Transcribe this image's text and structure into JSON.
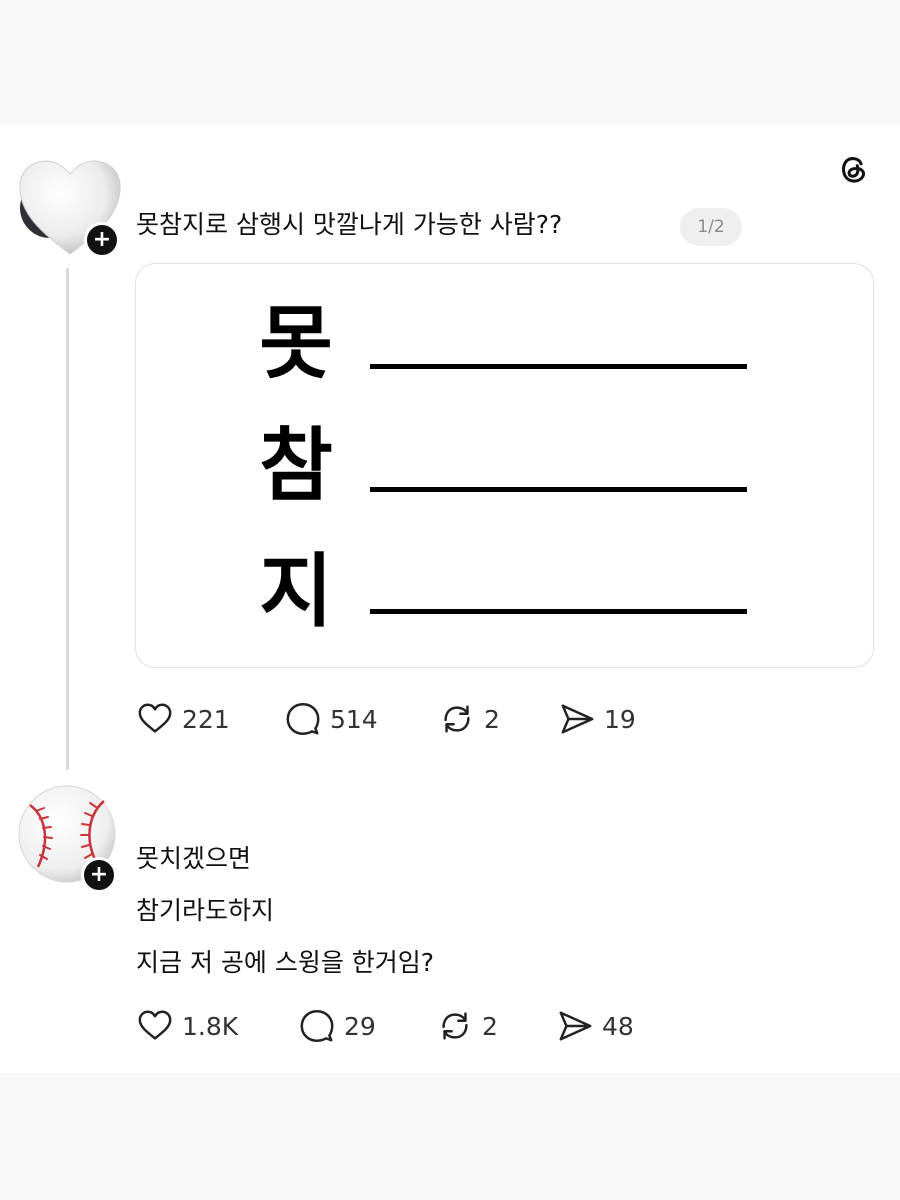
{
  "post": {
    "text": "못참지로 삼행시 맛깔나게 가능한 사람??",
    "page_indicator": "1/2",
    "image": {
      "chars": [
        "못",
        "참",
        "지"
      ]
    },
    "stats": {
      "likes": "221",
      "comments": "514",
      "reposts": "2",
      "shares": "19"
    }
  },
  "reply": {
    "lines": [
      "못치겠으면",
      "참기라도하지",
      "지금 저 공에 스윙을 한거임?"
    ],
    "stats": {
      "likes": "1.8K",
      "comments": "29",
      "reposts": "2",
      "shares": "48"
    }
  },
  "icons": {
    "app_logo": "threads-icon",
    "avatar_1": "white-heart-icon",
    "avatar_2": "baseball-icon",
    "follow": "plus-icon",
    "like": "heart-outline-icon",
    "comment": "comment-bubble-icon",
    "repost": "repost-icon",
    "share": "send-icon"
  }
}
